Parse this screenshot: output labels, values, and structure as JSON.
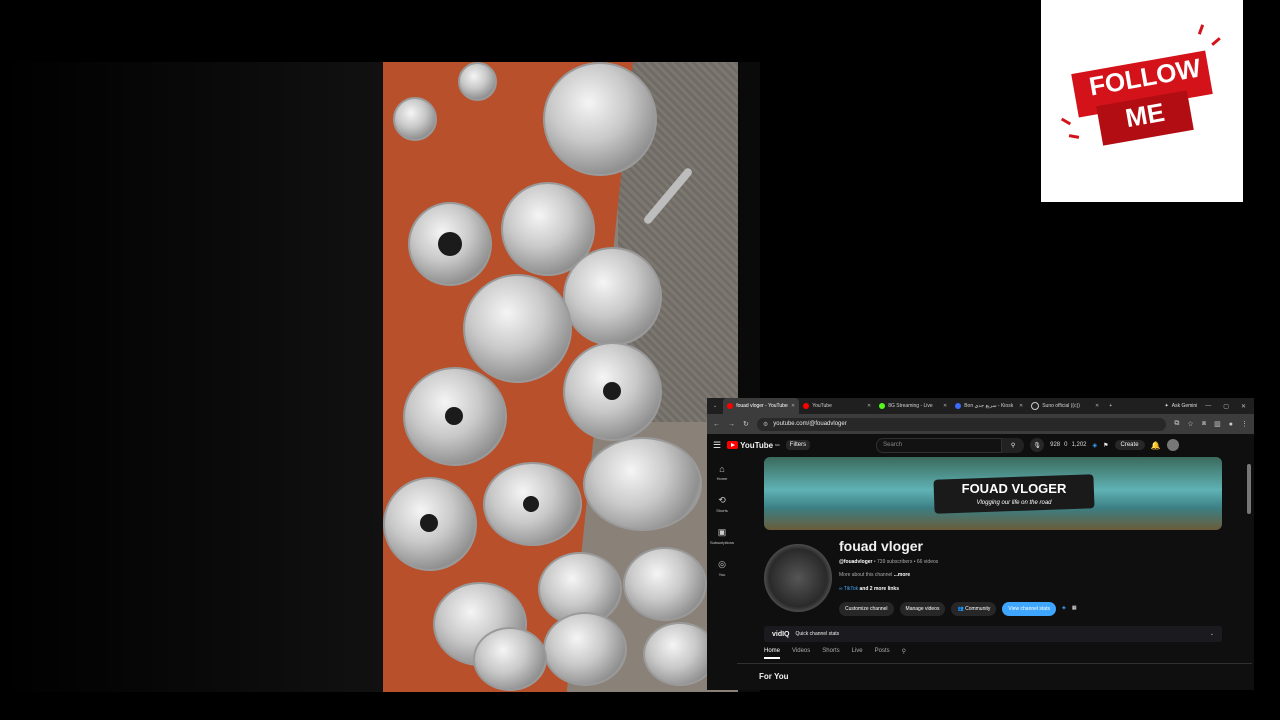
{
  "follow_card": {
    "line1": "FOLLOW",
    "line2": "ME",
    "color": "#d4121a"
  },
  "browser": {
    "tabs": [
      {
        "label": "fouad vloger - YouTube",
        "favicon": "youtube-icon",
        "active": true
      },
      {
        "label": "YouTube",
        "favicon": "youtube-icon",
        "active": false
      },
      {
        "label": "8G Streaming - Live",
        "favicon": "kick-icon",
        "active": false
      },
      {
        "label": "Bon سريع جدي - Kiosk",
        "favicon": "globe-icon",
        "active": false
      },
      {
        "label": "Suno official ((c))",
        "favicon": "tiktok-icon",
        "active": false
      }
    ],
    "new_tab": "+",
    "ask_gemini": "Ask Gemini",
    "url": "youtube.com/@fouadvloger"
  },
  "youtube": {
    "logo": "YouTube",
    "logo_sup": "MA",
    "filters": "Filters",
    "search_placeholder": "Search",
    "stats": {
      "views": "928",
      "zero": "0",
      "subs": "1,202"
    },
    "create": "Create",
    "sidebar": [
      {
        "icon": "home-icon",
        "label": "Home"
      },
      {
        "icon": "shorts-icon",
        "label": "Shorts"
      },
      {
        "icon": "subscriptions-icon",
        "label": "Subscriptions"
      },
      {
        "icon": "you-icon",
        "label": "You"
      }
    ],
    "banner": {
      "title": "FOUAD VLOGER",
      "subtitle": "Vlogging our life on the road"
    },
    "channel": {
      "name": "fouad vloger",
      "handle": "@fouadvloger",
      "meta": " • 739 subscribers • 66 videos",
      "about": "More about this channel",
      "more": "...more",
      "link_main": "TikTok",
      "link_more": " and 2 more links"
    },
    "buttons": {
      "customize": "Customize channel",
      "manage": "Manage videos",
      "community": "Community",
      "stats": "View channel stats"
    },
    "vidiq": {
      "logo": "vidIQ",
      "label": "Quick channel stats"
    },
    "tabs": [
      "Home",
      "Videos",
      "Shorts",
      "Live",
      "Posts"
    ],
    "section": "For You"
  }
}
